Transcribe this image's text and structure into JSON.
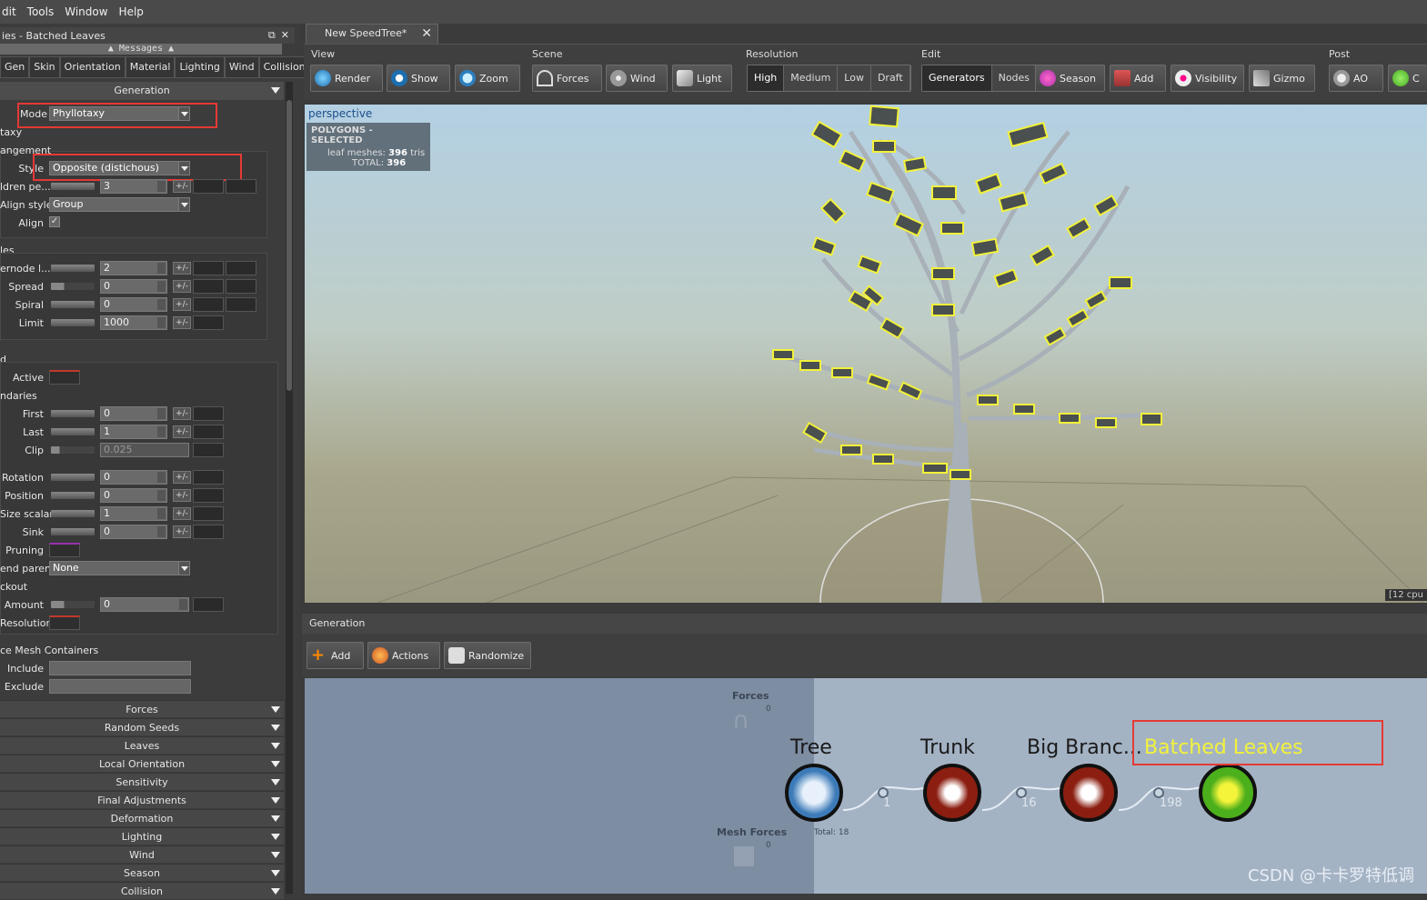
{
  "menu": [
    "dit",
    "Tools",
    "Window",
    "Help"
  ],
  "left_panel": {
    "title": "ies - Batched Leaves",
    "messages_label": "Messages",
    "tabs": [
      "Gen",
      "Skin",
      "Orientation",
      "Material",
      "Lighting",
      "Wind",
      "Collision"
    ],
    "section_generation": "Generation",
    "mode_label": "Mode",
    "mode_value": "Phyllotaxy",
    "taxy_label": "taxy",
    "arrangement_label": "angement",
    "style_label": "Style",
    "style_value": "Opposite (distichous)",
    "children_label": "ldren pe...",
    "children_value": "3",
    "align_style_label": "Align style",
    "align_style_value": "Group",
    "align_label": "Align",
    "les_label": "les",
    "internode_label": "ernode l...",
    "internode_value": "2",
    "spread_label": "Spread",
    "spread_value": "0",
    "spiral_label": "Spiral",
    "spiral_value": "0",
    "limit_label": "Limit",
    "limit_value": "1000",
    "d_label": "d",
    "active_label": "Active",
    "boundaries_label": "ndaries",
    "first_label": "First",
    "first_value": "0",
    "last_label": "Last",
    "last_value": "1",
    "clip_label": "Clip",
    "clip_value": "0.025",
    "rotation_label": "Rotation",
    "rotation_value": "0",
    "position_label": "Position",
    "position_value": "0",
    "size_scalar_label": "Size scalar",
    "size_scalar_value": "1",
    "sink_label": "Sink",
    "sink_value": "0",
    "pruning_label": "Pruning",
    "end_parent_label": "end parent",
    "end_parent_value": "None",
    "knockout_label": "ckout",
    "amount_label": "Amount",
    "amount_value": "0",
    "resolution_label": "Resolution",
    "mesh_containers_label": "ce Mesh Containers",
    "include_label": "Include",
    "exclude_label": "Exclude",
    "pm": "+/-",
    "collapsed_sections": [
      "Forces",
      "Random Seeds",
      "Leaves",
      "Local Orientation",
      "Sensitivity",
      "Final Adjustments",
      "Deformation",
      "Lighting",
      "Wind",
      "Season",
      "Collision"
    ]
  },
  "doc_tab": {
    "title": "New SpeedTree*",
    "close": "✕"
  },
  "toolbar": {
    "view_label": "View",
    "scene_label": "Scene",
    "resolution_label": "Resolution",
    "edit_label": "Edit",
    "post_label": "Post",
    "render": "Render",
    "show": "Show",
    "zoom": "Zoom",
    "forces": "Forces",
    "wind": "Wind",
    "light": "Light",
    "resolutions": [
      "High",
      "Medium",
      "Low",
      "Draft"
    ],
    "selected_resolution": "High",
    "generators": "Generators",
    "nodes": "Nodes",
    "season": "Season",
    "add": "Add",
    "visibility": "Visibility",
    "gizmo": "Gizmo",
    "ao": "AO",
    "post_more": "C"
  },
  "viewport": {
    "label": "perspective",
    "stats_title": "POLYGONS - SELECTED",
    "leaf_meshes_label": "leaf meshes:",
    "leaf_meshes_value": "396",
    "leaf_meshes_unit": "tris",
    "total_label": "TOTAL:",
    "total_value": "396",
    "cpu": "[12 cpu"
  },
  "generation_panel": {
    "title": "Generation",
    "add": "Add",
    "actions": "Actions",
    "randomize": "Randomize"
  },
  "graph": {
    "forces_label": "Forces",
    "forces_count": "0",
    "mesh_forces_label": "Mesh Forces",
    "mesh_forces_count": "0",
    "total": "Total: 18",
    "nodes": [
      {
        "title": "Tree"
      },
      {
        "title": "Trunk",
        "count": "1"
      },
      {
        "title": "Big Branc...",
        "count": "16"
      },
      {
        "title": "Batched Leaves",
        "count": "198"
      }
    ],
    "watermark": "CSDN @卡卡罗特低调"
  },
  "colors": {
    "highlight": "#e53935",
    "leaf_selected": "#f2f23a",
    "leaf_node": "#4caf1c",
    "trunk_node": "#8b1e10",
    "tree_node": "#3d7bb8"
  }
}
